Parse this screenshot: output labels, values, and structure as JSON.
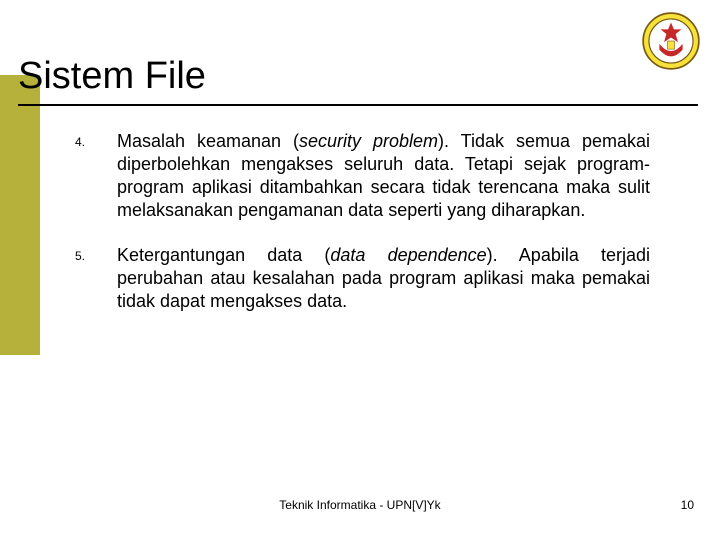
{
  "title": "Sistem File",
  "logo": {
    "name": "university-crest"
  },
  "items": [
    {
      "num": "4.",
      "lead": "Masalah keamanan (",
      "ital": "security problem",
      "tail": "). Tidak semua pemakai diperbolehkan mengakses seluruh data. Tetapi sejak program-program aplikasi ditambahkan secara tidak terencana maka sulit melaksanakan pengamanan data seperti yang diharapkan."
    },
    {
      "num": "5.",
      "lead": "Ketergantungan data (",
      "ital": "data dependence",
      "tail": "). Apabila terjadi perubahan atau kesalahan pada program aplikasi maka pemakai tidak dapat mengakses data."
    }
  ],
  "footer": "Teknik Informatika - UPN[V]Yk",
  "page": "10"
}
